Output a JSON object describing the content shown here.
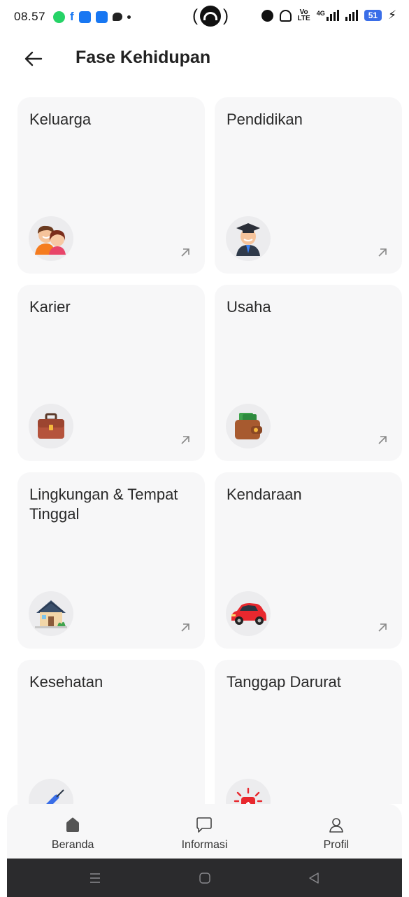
{
  "status_bar": {
    "time": "08.57",
    "battery": "51",
    "network": "4G",
    "volte_top": "Vo",
    "volte_bottom": "LTE"
  },
  "header": {
    "title": "Fase Kehidupan",
    "back_icon": "arrow-left-icon"
  },
  "cards": [
    {
      "title": "Keluarga",
      "icon": "family-icon"
    },
    {
      "title": "Pendidikan",
      "icon": "graduate-icon"
    },
    {
      "title": "Karier",
      "icon": "briefcase-icon"
    },
    {
      "title": "Usaha",
      "icon": "wallet-icon"
    },
    {
      "title": "Lingkungan & Tempat Tinggal",
      "icon": "house-icon"
    },
    {
      "title": "Kendaraan",
      "icon": "car-icon"
    },
    {
      "title": "Kesehatan",
      "icon": "syringe-icon"
    },
    {
      "title": "Tanggap Darurat",
      "icon": "emergency-siren-icon"
    }
  ],
  "bottom_nav": [
    {
      "label": "Beranda",
      "icon": "home-icon",
      "active": true
    },
    {
      "label": "Informasi",
      "icon": "chat-bubble-icon",
      "active": false
    },
    {
      "label": "Profil",
      "icon": "user-icon",
      "active": false
    }
  ],
  "colors": {
    "card_bg": "#f7f7f8",
    "nav_bg": "#f7f7f8",
    "system_nav_bg": "#2b2b2d",
    "battery": "#3a6ee8"
  }
}
